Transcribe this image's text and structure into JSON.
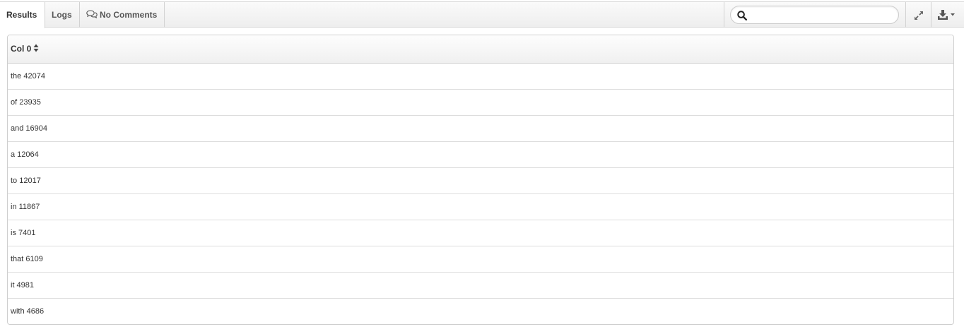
{
  "tabs": {
    "results": "Results",
    "logs": "Logs",
    "comments": "No Comments"
  },
  "search": {
    "placeholder": "",
    "value": ""
  },
  "icons": {
    "comments": "comments-icon",
    "search": "search-icon",
    "expand": "expand-icon",
    "download": "download-icon",
    "sort": "sort-icon"
  },
  "table": {
    "columns": [
      "Col 0"
    ],
    "rows": [
      "the 42074",
      "of 23935",
      "and 16904",
      "a 12064",
      "to 12017",
      "in 11867",
      "is 7401",
      "that 6109",
      "it 4981",
      "with 4686"
    ]
  }
}
